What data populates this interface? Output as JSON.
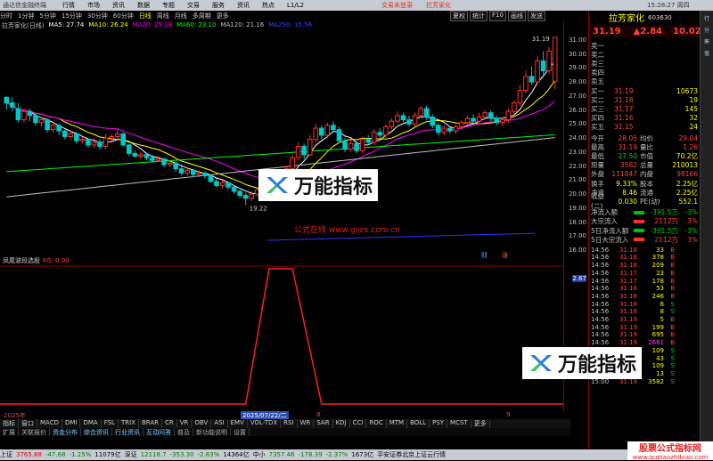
{
  "menubar": {
    "app": "通达信金融终端",
    "items": [
      "行情",
      "市场",
      "资讯",
      "数据",
      "专题",
      "交易",
      "服务",
      "资讯",
      "热点",
      "L1/L2"
    ],
    "alert1": "交易未登录",
    "alert2": "拉芳家化",
    "time": "15:28:27 周四"
  },
  "period": {
    "items": [
      "分时",
      "1分钟",
      "5分钟",
      "15分钟",
      "30分钟",
      "60分钟",
      "日线",
      "周线",
      "月线",
      "多周期",
      "更多"
    ],
    "active": "日线"
  },
  "rtools": [
    "夏权",
    "统计",
    "F10",
    "画线",
    "发送"
  ],
  "legend": {
    "name": "拉芳家化(日线)",
    "ma": [
      {
        "label": "MA5: 27.74",
        "color": "#ffffff"
      },
      {
        "label": "MA10: 26.24",
        "color": "#ffff00"
      },
      {
        "label": "MA20: 25.18",
        "color": "#ff00ff"
      },
      {
        "label": "MA60: 23.10",
        "color": "#00ff00"
      },
      {
        "label": "MA120: 21.16",
        "color": "#c0c0c0"
      },
      {
        "label": "MA250: 15.56",
        "color": "#4040ff"
      }
    ]
  },
  "annotations": {
    "high": "31.19",
    "low": "19.22"
  },
  "indicator": {
    "label": "凤尾波段选股",
    "value": "XG: 0.00",
    "axis_value": "2.67"
  },
  "yaxis": [
    "31.00",
    "30.00",
    "29.00",
    "28.00",
    "27.00",
    "26.00",
    "25.00",
    "24.00",
    "23.00",
    "22.00",
    "21.00",
    "20.00",
    "19.00",
    "18.00",
    "17.00",
    "16.00"
  ],
  "dates": {
    "left": "2025年",
    "mid": "2025/07/22/二",
    "m8": "8",
    "m9": "9"
  },
  "tabs": [
    "指标",
    "窗口",
    "MACD",
    "DMI",
    "DMA",
    "FSL",
    "TRIX",
    "BRAR",
    "CR",
    "VR",
    "OBV",
    "ASI",
    "EMV",
    "VOL-TDX",
    "RSI",
    "WR",
    "SAR",
    "KDJ",
    "CCI",
    "ROC",
    "MTM",
    "BOLL",
    "PSY",
    "MCST",
    "更多"
  ],
  "tabs2": [
    "扩展",
    "关联报价",
    "资金分布",
    "综合资讯",
    "行业资讯",
    "互动问答",
    "普及",
    "新功能说明",
    "设置"
  ],
  "status": [
    {
      "t": "上证",
      "c": ""
    },
    {
      "t": "3765.88",
      "c": "r"
    },
    {
      "t": "-47.68",
      "c": "g"
    },
    {
      "t": "-1.25%",
      "c": "g"
    },
    {
      "t": "11079亿",
      "c": ""
    },
    {
      "t": "深证",
      "c": ""
    },
    {
      "t": "12118.7",
      "c": "g"
    },
    {
      "t": "-353.30",
      "c": "g"
    },
    {
      "t": "-2.83%",
      "c": "g"
    },
    {
      "t": "14364亿",
      "c": ""
    },
    {
      "t": "中小",
      "c": ""
    },
    {
      "t": "7357.46",
      "c": "g"
    },
    {
      "t": "-178.39",
      "c": "g"
    },
    {
      "t": "-2.37%",
      "c": "g"
    },
    {
      "t": "1673亿",
      "c": ""
    },
    {
      "t": "平安证券北京上证云行情",
      "c": ""
    }
  ],
  "stock": {
    "name": "拉芳家化",
    "code": "603630",
    "price": "31.19",
    "change": "▲2.84",
    "pct": "10.02%"
  },
  "asks": [
    {
      "l": "卖五",
      "p": "",
      "n": ""
    },
    {
      "l": "卖四",
      "p": "",
      "n": ""
    },
    {
      "l": "卖三",
      "p": "",
      "n": ""
    },
    {
      "l": "卖二",
      "p": "",
      "n": ""
    },
    {
      "l": "卖一",
      "p": "",
      "n": ""
    }
  ],
  "bids": [
    {
      "l": "买一",
      "p": "31.19",
      "n": "10673"
    },
    {
      "l": "买二",
      "p": "31.18",
      "n": "19"
    },
    {
      "l": "买三",
      "p": "31.17",
      "n": "145"
    },
    {
      "l": "买四",
      "p": "31.16",
      "n": "32"
    },
    {
      "l": "买五",
      "p": "31.15",
      "n": "24"
    }
  ],
  "stats": [
    {
      "l": "今开",
      "v": "28.05",
      "l2": "均价",
      "v2": "29.04"
    },
    {
      "l": "最高",
      "v": "31.19",
      "l2": "量比",
      "v2": "1.26"
    },
    {
      "l": "最低",
      "v": "27.50",
      "l2": "市值",
      "v2": "70.2亿"
    },
    {
      "l": "现量",
      "v": "3582",
      "l2": "总量",
      "v2": "210013"
    },
    {
      "l": "外盘",
      "v": "111847",
      "l2": "内盘",
      "v2": "98166"
    },
    {
      "l": "换手",
      "v": "9.33%",
      "l2": "股本",
      "v2": "2.25亿"
    },
    {
      "l": "净资",
      "v": "8.46",
      "l2": "流通",
      "v2": "2.25亿"
    },
    {
      "l": "收益(二)",
      "v": "0.030",
      "l2": "PE(动)",
      "v2": "552.1"
    }
  ],
  "flows": [
    {
      "l": "净流入额",
      "v": "-391.5万",
      "p": "-3%"
    },
    {
      "l": "大宗流入",
      "v": "2112万",
      "p": "3%"
    },
    {
      "l": "5日净流入额",
      "v": "-391.5万",
      "p": "-3%"
    },
    {
      "l": "5日大宗流入",
      "v": "2112万",
      "p": "3%"
    }
  ],
  "ticks": [
    {
      "t": "14:56",
      "p": "31.18",
      "q": "33",
      "d": "B"
    },
    {
      "t": "14:56",
      "p": "31.18",
      "q": "378",
      "d": "B"
    },
    {
      "t": "14:56",
      "p": "31.18",
      "q": "209",
      "d": "B"
    },
    {
      "t": "14:56",
      "p": "31.17",
      "q": "23",
      "d": "B"
    },
    {
      "t": "14:56",
      "p": "31.17",
      "q": "178",
      "d": "B"
    },
    {
      "t": "14:56",
      "p": "31.18",
      "q": "53",
      "d": "B"
    },
    {
      "t": "14:56",
      "p": "31.18",
      "q": "246",
      "d": "B"
    },
    {
      "t": "14:56",
      "p": "31.18",
      "q": "8",
      "d": "S"
    },
    {
      "t": "14:56",
      "p": "31.18",
      "q": "8",
      "d": "S"
    },
    {
      "t": "14:56",
      "p": "31.19",
      "q": "5",
      "d": "B"
    },
    {
      "t": "14:56",
      "p": "31.19",
      "q": "199",
      "d": "B"
    },
    {
      "t": "14:56",
      "p": "31.19",
      "q": "695",
      "d": "B"
    },
    {
      "t": "14:56",
      "p": "31.19",
      "q": "2661",
      "d": "B"
    },
    {
      "t": "14:56",
      "p": "31.19",
      "q": "109",
      "d": "S"
    },
    {
      "t": "14:56",
      "p": "31.19",
      "q": "43",
      "d": "S"
    },
    {
      "t": "14:56",
      "p": "31.19",
      "q": "109",
      "d": "S"
    },
    {
      "t": "14:57",
      "p": "31.19",
      "q": "13",
      "d": "S"
    },
    {
      "t": "15:00",
      "p": "31.19",
      "q": "3582",
      "d": "S"
    }
  ],
  "watermark": {
    "text": "万能指标",
    "site": "公式在线  www.gszx.com.cn",
    "corner1": "股票公式指标网",
    "corner2": "www.gupiaozhibiao.com"
  },
  "chart_data": {
    "type": "candlestick",
    "ma_labels": [
      "MA5",
      "MA10",
      "MA20",
      "MA60",
      "MA120",
      "MA250"
    ],
    "ylim": [
      16,
      31.5
    ],
    "high": 31.19,
    "low": 19.22,
    "candles": [
      [
        26.9,
        26.5,
        27.0,
        26.0
      ],
      [
        26.5,
        26.2,
        26.9,
        25.9
      ],
      [
        26.1,
        25.3,
        26.5,
        25.1
      ],
      [
        25.3,
        25.9,
        26.1,
        25.1
      ],
      [
        25.9,
        25.6,
        26.1,
        25.2
      ],
      [
        25.6,
        25.1,
        25.8,
        24.9
      ],
      [
        25.1,
        25.3,
        25.5,
        24.8
      ],
      [
        25.3,
        24.6,
        25.4,
        24.4
      ],
      [
        24.6,
        24.9,
        25.0,
        24.4
      ],
      [
        24.9,
        24.5,
        25.0,
        24.2
      ],
      [
        24.5,
        24.1,
        24.6,
        23.9
      ],
      [
        24.1,
        24.3,
        24.5,
        23.9
      ],
      [
        24.3,
        23.8,
        24.4,
        23.6
      ],
      [
        23.8,
        23.9,
        24.1,
        23.6
      ],
      [
        23.9,
        23.5,
        24.0,
        23.3
      ],
      [
        23.5,
        23.7,
        24.0,
        23.3
      ],
      [
        23.7,
        23.4,
        23.9,
        23.2
      ],
      [
        23.4,
        24.0,
        24.3,
        23.2
      ],
      [
        24.0,
        24.1,
        24.3,
        23.8
      ],
      [
        24.1,
        24.3,
        24.6,
        23.9
      ],
      [
        24.3,
        23.5,
        24.4,
        23.4
      ],
      [
        23.5,
        22.9,
        23.6,
        22.7
      ],
      [
        22.9,
        22.7,
        23.1,
        22.6
      ],
      [
        22.7,
        22.8,
        23.0,
        22.5
      ],
      [
        22.8,
        22.6,
        22.9,
        22.4
      ],
      [
        22.6,
        22.4,
        22.8,
        22.2
      ],
      [
        22.4,
        22.5,
        22.7,
        22.3
      ],
      [
        22.5,
        22.1,
        22.6,
        21.9
      ],
      [
        22.1,
        22.2,
        22.4,
        21.9
      ],
      [
        22.2,
        21.8,
        22.3,
        21.6
      ],
      [
        21.8,
        21.5,
        22.0,
        21.3
      ],
      [
        21.5,
        21.7,
        21.9,
        21.3
      ],
      [
        21.7,
        21.4,
        21.8,
        21.2
      ],
      [
        21.4,
        21.5,
        21.7,
        21.2
      ],
      [
        21.5,
        21.3,
        21.6,
        21.1
      ],
      [
        21.3,
        20.9,
        21.4,
        20.8
      ],
      [
        20.9,
        20.6,
        21.1,
        20.5
      ],
      [
        20.6,
        20.8,
        21.0,
        20.4
      ],
      [
        20.8,
        20.5,
        20.9,
        20.3
      ],
      [
        20.5,
        20.2,
        20.6,
        20.0
      ],
      [
        20.2,
        19.9,
        20.3,
        19.7
      ],
      [
        19.9,
        19.7,
        20.1,
        19.22
      ],
      [
        19.7,
        20.0,
        20.2,
        19.5
      ],
      [
        20.0,
        20.3,
        20.5,
        19.8
      ],
      [
        20.3,
        20.2,
        20.5,
        20.0
      ],
      [
        20.2,
        20.5,
        20.6,
        20.0
      ],
      [
        20.5,
        20.8,
        21.0,
        20.3
      ],
      [
        20.8,
        21.2,
        21.4,
        20.6
      ],
      [
        21.2,
        21.8,
        22.0,
        21.0
      ],
      [
        21.8,
        22.6,
        22.8,
        21.6
      ],
      [
        22.6,
        23.4,
        23.7,
        22.4
      ],
      [
        23.4,
        22.8,
        23.6,
        22.5
      ],
      [
        22.8,
        23.9,
        24.2,
        22.7
      ],
      [
        23.9,
        24.7,
        25.0,
        23.7
      ],
      [
        24.7,
        24.2,
        24.9,
        23.9
      ],
      [
        24.2,
        24.9,
        25.1,
        24.0
      ],
      [
        24.9,
        24.6,
        25.2,
        24.4
      ],
      [
        24.6,
        23.8,
        24.8,
        23.6
      ],
      [
        23.8,
        23.2,
        24.0,
        23.0
      ],
      [
        23.2,
        23.6,
        23.9,
        23.0
      ],
      [
        23.6,
        23.1,
        23.8,
        22.9
      ],
      [
        23.1,
        23.9,
        24.1,
        22.9
      ],
      [
        23.9,
        23.7,
        24.2,
        23.5
      ],
      [
        23.7,
        24.4,
        24.6,
        23.5
      ],
      [
        24.4,
        24.2,
        24.7,
        24.0
      ],
      [
        24.2,
        24.8,
        25.0,
        24.0
      ],
      [
        24.8,
        25.2,
        25.4,
        24.6
      ],
      [
        25.2,
        25.6,
        25.9,
        25.0
      ],
      [
        25.6,
        25.3,
        25.8,
        25.1
      ],
      [
        25.3,
        25.0,
        25.6,
        24.8
      ],
      [
        25.0,
        25.6,
        25.8,
        24.8
      ],
      [
        25.6,
        26.1,
        26.3,
        25.4
      ],
      [
        26.1,
        25.5,
        26.3,
        25.3
      ],
      [
        25.5,
        24.9,
        25.7,
        24.7
      ],
      [
        24.9,
        24.4,
        25.1,
        24.2
      ],
      [
        24.4,
        24.7,
        24.9,
        24.2
      ],
      [
        24.7,
        24.5,
        24.9,
        24.3
      ],
      [
        24.5,
        24.8,
        25.0,
        24.3
      ],
      [
        24.8,
        25.1,
        25.3,
        24.6
      ],
      [
        25.1,
        25.4,
        25.6,
        24.9
      ],
      [
        25.4,
        25.2,
        25.7,
        25.0
      ],
      [
        25.2,
        25.5,
        25.8,
        25.0
      ],
      [
        25.5,
        25.8,
        26.0,
        25.3
      ],
      [
        25.8,
        25.4,
        26.0,
        25.2
      ],
      [
        25.4,
        25.1,
        25.6,
        24.9
      ],
      [
        25.1,
        25.3,
        25.5,
        24.9
      ],
      [
        25.3,
        25.9,
        26.1,
        25.1
      ],
      [
        25.9,
        26.5,
        26.7,
        25.7
      ],
      [
        26.5,
        27.4,
        27.8,
        26.3
      ],
      [
        27.4,
        28.4,
        28.8,
        27.2
      ],
      [
        28.4,
        28.0,
        29.1,
        27.8
      ],
      [
        28.0,
        29.5,
        29.8,
        27.9
      ],
      [
        29.5,
        28.8,
        30.2,
        28.5
      ],
      [
        28.8,
        30.2,
        30.5,
        28.6
      ],
      [
        28.05,
        31.19,
        31.19,
        27.5
      ]
    ],
    "indicator": {
      "name": "凤尾波段选股",
      "values_note": "single pulse near day 46",
      "ylim": [
        0,
        2.67
      ]
    }
  }
}
